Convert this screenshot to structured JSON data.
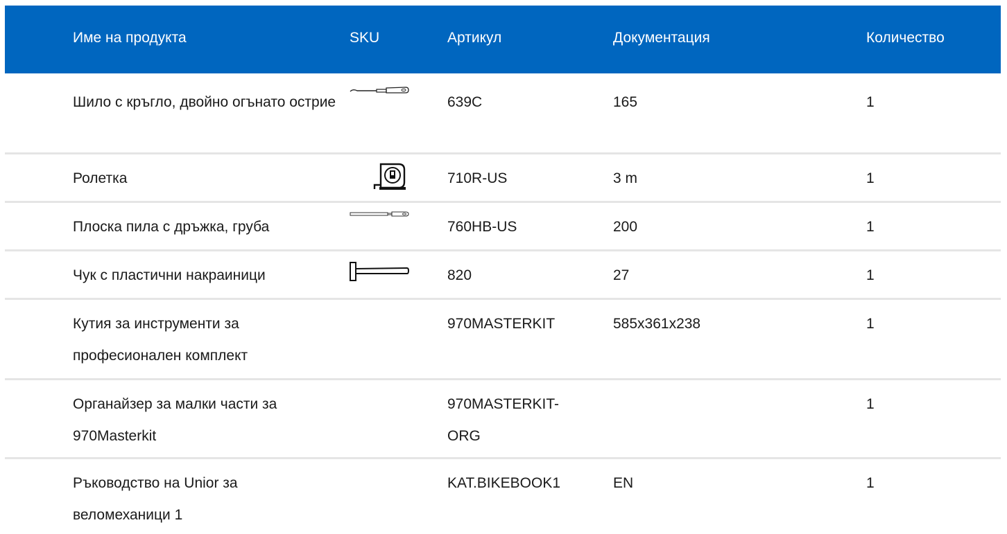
{
  "header": {
    "name": "Име на продукта",
    "sku": "SKU",
    "article": "Артикул",
    "docs": "Документация",
    "qty": "Количество"
  },
  "colors": {
    "header_bg": "#0066bf",
    "divider": "#e5e5e5"
  },
  "rows": [
    {
      "name": "Шило с кръгло, двойно огънато острие",
      "icon": "awl-icon",
      "article": "639C",
      "doc": "165",
      "qty": "1"
    },
    {
      "name": "Ролетка",
      "icon": "tape-measure-icon",
      "article": "710R-US",
      "doc": "3 m",
      "qty": "1"
    },
    {
      "name": "Плоска пила с дръжка, груба",
      "icon": "flat-file-icon",
      "article": "760HB-US",
      "doc": "200",
      "qty": "1"
    },
    {
      "name": "Чук с пластични накраиници",
      "icon": "hammer-icon",
      "article": "820",
      "doc": "27",
      "qty": "1"
    },
    {
      "name": "Кутия за инструменти за професионален комплект",
      "icon": "",
      "article": "970MASTERKIT",
      "doc": "585x361x238",
      "qty": "1"
    },
    {
      "name": "Органайзер за малки части за 970Masterkit",
      "icon": "",
      "article": "970MASTERKIT-ORG",
      "doc": "",
      "qty": "1"
    },
    {
      "name": "Ръководство на Unior за веломеханици 1",
      "icon": "",
      "article": "KAT.BIKEBOOK1",
      "doc": "EN",
      "qty": "1"
    }
  ]
}
